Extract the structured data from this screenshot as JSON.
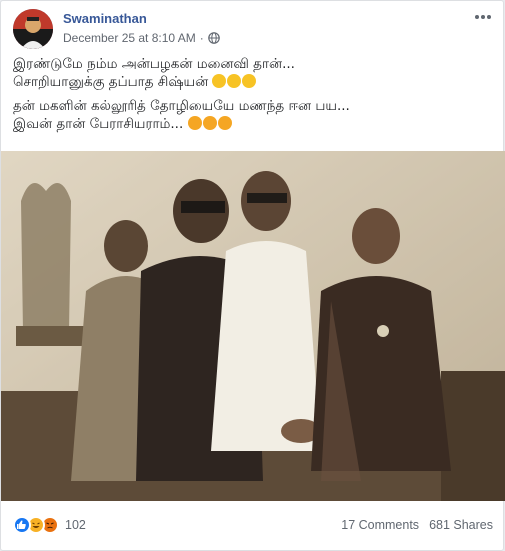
{
  "post": {
    "author": "Swaminathan",
    "timestamp": "December 25 at 8:10 AM",
    "privacy_icon": "globe-icon",
    "more_icon": "more-options-icon",
    "text_lines": [
      "இரண்டுமே நம்ம அன்பழகன் மனைவி தான்...",
      "சொறியானுக்கு தப்பாத சிஷ்யன்",
      "தன் மகளின் கல்லூரித் தோழியையே மணந்த ஈன பய...",
      "இவன் தான் பேராசியராம்..."
    ],
    "line2_emojis": [
      "laughing-emoji",
      "laughing-emoji",
      "laughing-emoji"
    ],
    "line4_emojis": [
      "sad-emoji",
      "sad-emoji",
      "sad-emoji"
    ]
  },
  "footer": {
    "reactions": [
      "like-reaction-icon",
      "haha-reaction-icon",
      "angry-reaction-icon"
    ],
    "reaction_count": "102",
    "comments": "17 Comments",
    "shares": "681 Shares"
  },
  "colors": {
    "author": "#385898",
    "meta": "#616770",
    "like": "#1877f2",
    "haha": "#f7b125",
    "angry": "#e9710f"
  }
}
